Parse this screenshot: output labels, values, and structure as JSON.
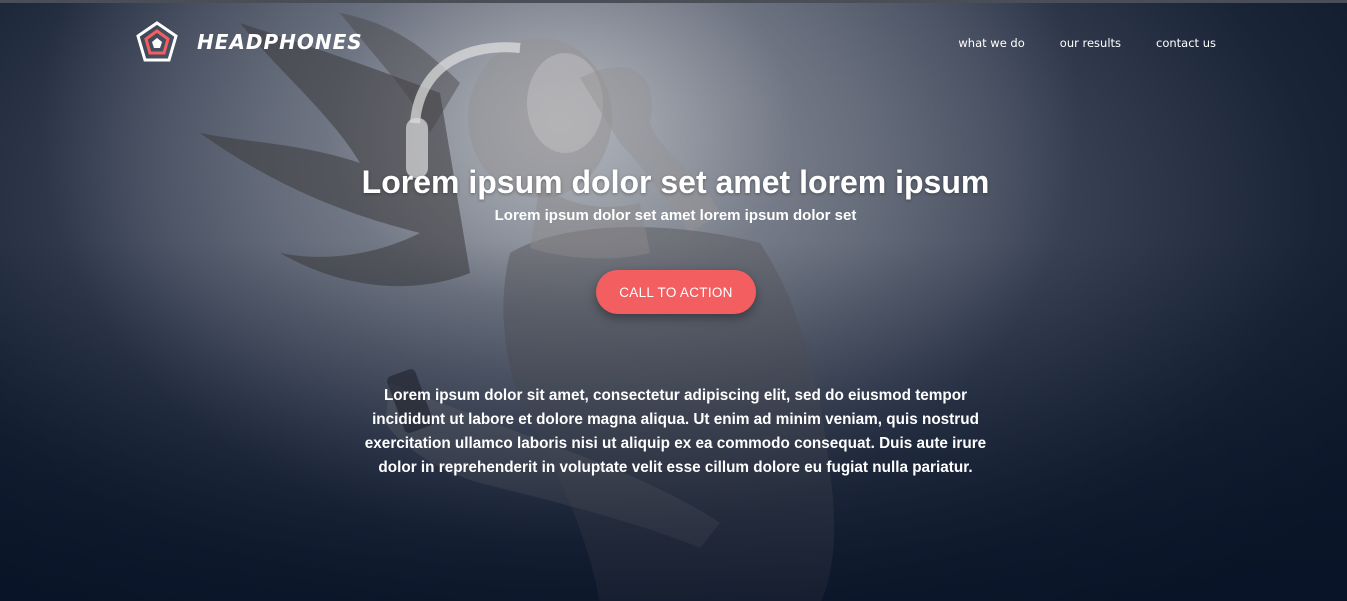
{
  "brand": {
    "logo_icon": "pentagon-logo-icon",
    "name": "HEADPHONES",
    "accent_color": "#f35e61"
  },
  "nav": {
    "items": [
      {
        "label": "what we do"
      },
      {
        "label": "our results"
      },
      {
        "label": "contact us"
      }
    ]
  },
  "hero": {
    "headline": "Lorem ipsum dolor set amet lorem ipsum",
    "subheadline": "Lorem ipsum dolor set amet lorem ipsum dolor set",
    "cta_label": "CALL TO ACTION",
    "body": "Lorem ipsum dolor sit amet, consectetur adipiscing elit, sed do eiusmod tempor incididunt ut labore et dolore magna aliqua. Ut enim ad minim veniam, quis nostrud exercitation ullamco laboris nisi ut aliquip ex ea commodo consequat. Duis aute irure dolor in reprehenderit in voluptate velit esse cillum dolore eu fugiat nulla pariatur."
  }
}
